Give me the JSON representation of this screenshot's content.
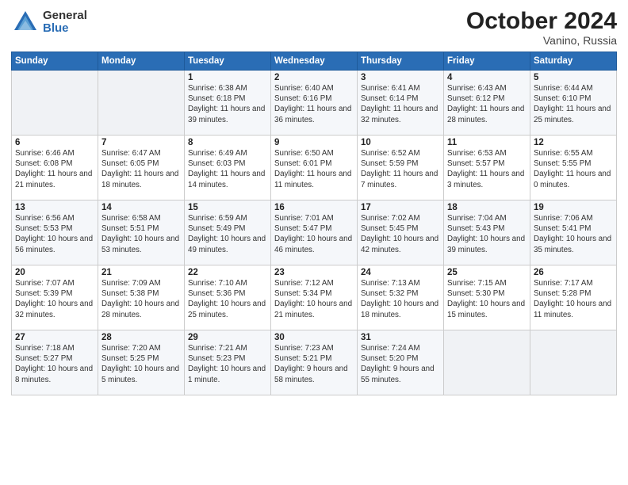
{
  "logo": {
    "general": "General",
    "blue": "Blue"
  },
  "title": {
    "month": "October 2024",
    "location": "Vanino, Russia"
  },
  "weekdays": [
    "Sunday",
    "Monday",
    "Tuesday",
    "Wednesday",
    "Thursday",
    "Friday",
    "Saturday"
  ],
  "weeks": [
    [
      {
        "day": "",
        "info": ""
      },
      {
        "day": "",
        "info": ""
      },
      {
        "day": "1",
        "info": "Sunrise: 6:38 AM\nSunset: 6:18 PM\nDaylight: 11 hours and 39 minutes."
      },
      {
        "day": "2",
        "info": "Sunrise: 6:40 AM\nSunset: 6:16 PM\nDaylight: 11 hours and 36 minutes."
      },
      {
        "day": "3",
        "info": "Sunrise: 6:41 AM\nSunset: 6:14 PM\nDaylight: 11 hours and 32 minutes."
      },
      {
        "day": "4",
        "info": "Sunrise: 6:43 AM\nSunset: 6:12 PM\nDaylight: 11 hours and 28 minutes."
      },
      {
        "day": "5",
        "info": "Sunrise: 6:44 AM\nSunset: 6:10 PM\nDaylight: 11 hours and 25 minutes."
      }
    ],
    [
      {
        "day": "6",
        "info": "Sunrise: 6:46 AM\nSunset: 6:08 PM\nDaylight: 11 hours and 21 minutes."
      },
      {
        "day": "7",
        "info": "Sunrise: 6:47 AM\nSunset: 6:05 PM\nDaylight: 11 hours and 18 minutes."
      },
      {
        "day": "8",
        "info": "Sunrise: 6:49 AM\nSunset: 6:03 PM\nDaylight: 11 hours and 14 minutes."
      },
      {
        "day": "9",
        "info": "Sunrise: 6:50 AM\nSunset: 6:01 PM\nDaylight: 11 hours and 11 minutes."
      },
      {
        "day": "10",
        "info": "Sunrise: 6:52 AM\nSunset: 5:59 PM\nDaylight: 11 hours and 7 minutes."
      },
      {
        "day": "11",
        "info": "Sunrise: 6:53 AM\nSunset: 5:57 PM\nDaylight: 11 hours and 3 minutes."
      },
      {
        "day": "12",
        "info": "Sunrise: 6:55 AM\nSunset: 5:55 PM\nDaylight: 11 hours and 0 minutes."
      }
    ],
    [
      {
        "day": "13",
        "info": "Sunrise: 6:56 AM\nSunset: 5:53 PM\nDaylight: 10 hours and 56 minutes."
      },
      {
        "day": "14",
        "info": "Sunrise: 6:58 AM\nSunset: 5:51 PM\nDaylight: 10 hours and 53 minutes."
      },
      {
        "day": "15",
        "info": "Sunrise: 6:59 AM\nSunset: 5:49 PM\nDaylight: 10 hours and 49 minutes."
      },
      {
        "day": "16",
        "info": "Sunrise: 7:01 AM\nSunset: 5:47 PM\nDaylight: 10 hours and 46 minutes."
      },
      {
        "day": "17",
        "info": "Sunrise: 7:02 AM\nSunset: 5:45 PM\nDaylight: 10 hours and 42 minutes."
      },
      {
        "day": "18",
        "info": "Sunrise: 7:04 AM\nSunset: 5:43 PM\nDaylight: 10 hours and 39 minutes."
      },
      {
        "day": "19",
        "info": "Sunrise: 7:06 AM\nSunset: 5:41 PM\nDaylight: 10 hours and 35 minutes."
      }
    ],
    [
      {
        "day": "20",
        "info": "Sunrise: 7:07 AM\nSunset: 5:39 PM\nDaylight: 10 hours and 32 minutes."
      },
      {
        "day": "21",
        "info": "Sunrise: 7:09 AM\nSunset: 5:38 PM\nDaylight: 10 hours and 28 minutes."
      },
      {
        "day": "22",
        "info": "Sunrise: 7:10 AM\nSunset: 5:36 PM\nDaylight: 10 hours and 25 minutes."
      },
      {
        "day": "23",
        "info": "Sunrise: 7:12 AM\nSunset: 5:34 PM\nDaylight: 10 hours and 21 minutes."
      },
      {
        "day": "24",
        "info": "Sunrise: 7:13 AM\nSunset: 5:32 PM\nDaylight: 10 hours and 18 minutes."
      },
      {
        "day": "25",
        "info": "Sunrise: 7:15 AM\nSunset: 5:30 PM\nDaylight: 10 hours and 15 minutes."
      },
      {
        "day": "26",
        "info": "Sunrise: 7:17 AM\nSunset: 5:28 PM\nDaylight: 10 hours and 11 minutes."
      }
    ],
    [
      {
        "day": "27",
        "info": "Sunrise: 7:18 AM\nSunset: 5:27 PM\nDaylight: 10 hours and 8 minutes."
      },
      {
        "day": "28",
        "info": "Sunrise: 7:20 AM\nSunset: 5:25 PM\nDaylight: 10 hours and 5 minutes."
      },
      {
        "day": "29",
        "info": "Sunrise: 7:21 AM\nSunset: 5:23 PM\nDaylight: 10 hours and 1 minute."
      },
      {
        "day": "30",
        "info": "Sunrise: 7:23 AM\nSunset: 5:21 PM\nDaylight: 9 hours and 58 minutes."
      },
      {
        "day": "31",
        "info": "Sunrise: 7:24 AM\nSunset: 5:20 PM\nDaylight: 9 hours and 55 minutes."
      },
      {
        "day": "",
        "info": ""
      },
      {
        "day": "",
        "info": ""
      }
    ]
  ]
}
